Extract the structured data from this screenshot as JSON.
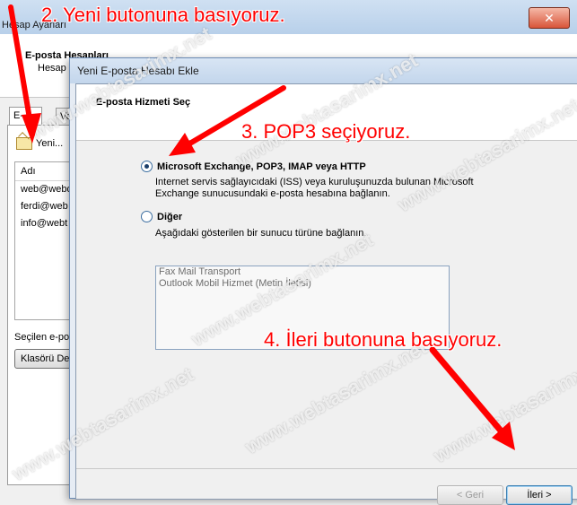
{
  "back_window": {
    "title": "Hesap Ayarları",
    "heading": "E-posta Hesapları",
    "subheading": "Hesap",
    "tabs": [
      "E-posta",
      "Ve"
    ],
    "new_button": "Yeni...",
    "list_header": "Adı",
    "accounts": [
      "web@webd",
      "ferdi@web",
      "info@webt"
    ],
    "selected_label": "Seçilen e-posta",
    "folder_button": "Klasörü De"
  },
  "dialog": {
    "title": "Yeni E-posta Hesabı Ekle",
    "section_title": "E-posta Hizmeti Seç",
    "option1_label": "Microsoft Exchange, POP3, IMAP veya HTTP",
    "option1_desc": "Internet servis sağlayıcıdaki (ISS) veya kuruluşunuzda bulunan Microsoft Exchange sunucusundaki e-posta hesabına bağlanın.",
    "option2_label": "Diğer",
    "option2_desc": "Aşağıdaki gösterilen bir sunucu türüne bağlanın.",
    "transports": [
      "Fax Mail Transport",
      "Outlook Mobil Hizmet (Metin İletisi)"
    ],
    "back_button": "< Geri",
    "next_button": "İleri >"
  },
  "annotations": {
    "step2": "2. Yeni butonuna basıyoruz.",
    "step3": "3. POP3 seçiyoruz.",
    "step4": "4. İleri butonuna basıyoruz."
  },
  "watermark": "www.webtasarimx.net",
  "colors": {
    "annotation": "#ff0000",
    "dialog_border": "#6b8bb5"
  }
}
